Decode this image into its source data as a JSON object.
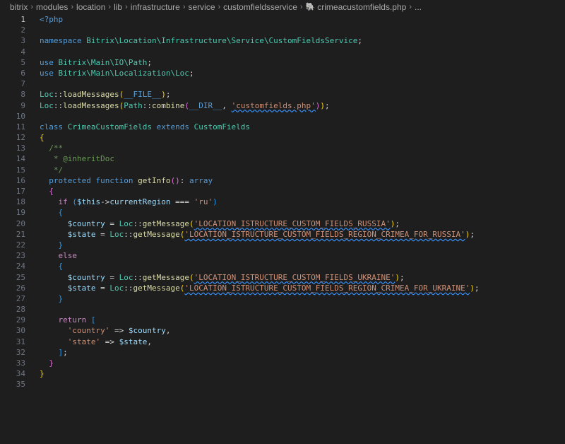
{
  "breadcrumb": {
    "items": [
      "bitrix",
      "modules",
      "location",
      "lib",
      "infrastructure",
      "service",
      "customfieldsservice"
    ],
    "file": "crimeacustomfields.php",
    "more": "..."
  },
  "editor": {
    "current_line": 1,
    "line_numbers": [
      "1",
      "2",
      "3",
      "4",
      "5",
      "6",
      "7",
      "8",
      "9",
      "10",
      "11",
      "12",
      "13",
      "14",
      "15",
      "16",
      "17",
      "18",
      "19",
      "20",
      "21",
      "22",
      "23",
      "24",
      "25",
      "26",
      "27",
      "28",
      "29",
      "30",
      "31",
      "32",
      "33",
      "34",
      "35"
    ],
    "lines": [
      [
        {
          "t": "<?php",
          "c": "tag"
        }
      ],
      [],
      [
        {
          "t": "namespace ",
          "c": "k"
        },
        {
          "t": "Bitrix\\Location\\Infrastructure\\Service\\CustomFieldsService",
          "c": "c"
        },
        {
          "t": ";",
          "c": "n"
        }
      ],
      [],
      [
        {
          "t": "use ",
          "c": "k"
        },
        {
          "t": "Bitrix\\Main\\IO\\Path",
          "c": "c"
        },
        {
          "t": ";",
          "c": "n"
        }
      ],
      [
        {
          "t": "use ",
          "c": "k"
        },
        {
          "t": "Bitrix\\Main\\Localization\\Loc",
          "c": "c"
        },
        {
          "t": ";",
          "c": "n"
        }
      ],
      [],
      [
        {
          "t": "Loc",
          "c": "c"
        },
        {
          "t": "::",
          "c": "n"
        },
        {
          "t": "loadMessages",
          "c": "f"
        },
        {
          "t": "(",
          "c": "b1"
        },
        {
          "t": "__FILE__",
          "c": "k"
        },
        {
          "t": ")",
          "c": "b1"
        },
        {
          "t": ";",
          "c": "n"
        }
      ],
      [
        {
          "t": "Loc",
          "c": "c"
        },
        {
          "t": "::",
          "c": "n"
        },
        {
          "t": "loadMessages",
          "c": "f"
        },
        {
          "t": "(",
          "c": "b1"
        },
        {
          "t": "Path",
          "c": "c"
        },
        {
          "t": "::",
          "c": "n"
        },
        {
          "t": "combine",
          "c": "f"
        },
        {
          "t": "(",
          "c": "b2"
        },
        {
          "t": "__DIR__",
          "c": "k"
        },
        {
          "t": ", ",
          "c": "n"
        },
        {
          "t": "'customfields.php'",
          "c": "s",
          "sq": true
        },
        {
          "t": ")",
          "c": "b2"
        },
        {
          "t": ")",
          "c": "b1"
        },
        {
          "t": ";",
          "c": "n"
        }
      ],
      [],
      [
        {
          "t": "class ",
          "c": "k"
        },
        {
          "t": "CrimeaCustomFields ",
          "c": "c"
        },
        {
          "t": "extends ",
          "c": "k"
        },
        {
          "t": "CustomFields",
          "c": "c"
        }
      ],
      [
        {
          "t": "{",
          "c": "b1"
        }
      ],
      [
        {
          "t": "  ",
          "c": "guide"
        },
        {
          "t": "/**",
          "c": "cm"
        }
      ],
      [
        {
          "t": "  ",
          "c": "guide"
        },
        {
          "t": " * @inheritDoc",
          "c": "cm"
        }
      ],
      [
        {
          "t": "  ",
          "c": "guide"
        },
        {
          "t": " */",
          "c": "cm"
        }
      ],
      [
        {
          "t": "  ",
          "c": "guide"
        },
        {
          "t": "protected ",
          "c": "k"
        },
        {
          "t": "function ",
          "c": "k"
        },
        {
          "t": "getInfo",
          "c": "f"
        },
        {
          "t": "()",
          "c": "b2"
        },
        {
          "t": ": ",
          "c": "n"
        },
        {
          "t": "array",
          "c": "k"
        }
      ],
      [
        {
          "t": "  ",
          "c": "guide"
        },
        {
          "t": "{",
          "c": "b2"
        }
      ],
      [
        {
          "t": "    ",
          "c": "guide"
        },
        {
          "t": "if ",
          "c": "kc"
        },
        {
          "t": "(",
          "c": "b3"
        },
        {
          "t": "$this",
          "c": "v"
        },
        {
          "t": "->",
          "c": "n"
        },
        {
          "t": "currentRegion ",
          "c": "v"
        },
        {
          "t": "=== ",
          "c": "n"
        },
        {
          "t": "'ru'",
          "c": "s"
        },
        {
          "t": ")",
          "c": "b3"
        }
      ],
      [
        {
          "t": "    ",
          "c": "guide"
        },
        {
          "t": "{",
          "c": "b3"
        }
      ],
      [
        {
          "t": "      ",
          "c": "guide"
        },
        {
          "t": "$country ",
          "c": "v"
        },
        {
          "t": "= ",
          "c": "n"
        },
        {
          "t": "Loc",
          "c": "c"
        },
        {
          "t": "::",
          "c": "n"
        },
        {
          "t": "getMessage",
          "c": "f"
        },
        {
          "t": "(",
          "c": "b1"
        },
        {
          "t": "'LOCATION_ISTRUCTURE_CUSTOM_FIELDS_RUSSIA'",
          "c": "s",
          "sq": true
        },
        {
          "t": ")",
          "c": "b1"
        },
        {
          "t": ";",
          "c": "n"
        }
      ],
      [
        {
          "t": "      ",
          "c": "guide"
        },
        {
          "t": "$state ",
          "c": "v"
        },
        {
          "t": "= ",
          "c": "n"
        },
        {
          "t": "Loc",
          "c": "c"
        },
        {
          "t": "::",
          "c": "n"
        },
        {
          "t": "getMessage",
          "c": "f"
        },
        {
          "t": "(",
          "c": "b1"
        },
        {
          "t": "'LOCATION_ISTRUCTURE_CUSTOM_FIELDS_REGION_CRIMEA_FOR_RUSSIA'",
          "c": "s",
          "sq": true
        },
        {
          "t": ")",
          "c": "b1"
        },
        {
          "t": ";",
          "c": "n"
        }
      ],
      [
        {
          "t": "    ",
          "c": "guide"
        },
        {
          "t": "}",
          "c": "b3"
        }
      ],
      [
        {
          "t": "    ",
          "c": "guide"
        },
        {
          "t": "else",
          "c": "kc"
        }
      ],
      [
        {
          "t": "    ",
          "c": "guide"
        },
        {
          "t": "{",
          "c": "b3"
        }
      ],
      [
        {
          "t": "      ",
          "c": "guide"
        },
        {
          "t": "$country ",
          "c": "v"
        },
        {
          "t": "= ",
          "c": "n"
        },
        {
          "t": "Loc",
          "c": "c"
        },
        {
          "t": "::",
          "c": "n"
        },
        {
          "t": "getMessage",
          "c": "f"
        },
        {
          "t": "(",
          "c": "b1"
        },
        {
          "t": "'LOCATION_ISTRUCTURE_CUSTOM_FIELDS_UKRAINE'",
          "c": "s",
          "sq": true
        },
        {
          "t": ")",
          "c": "b1"
        },
        {
          "t": ";",
          "c": "n"
        }
      ],
      [
        {
          "t": "      ",
          "c": "guide"
        },
        {
          "t": "$state ",
          "c": "v"
        },
        {
          "t": "= ",
          "c": "n"
        },
        {
          "t": "Loc",
          "c": "c"
        },
        {
          "t": "::",
          "c": "n"
        },
        {
          "t": "getMessage",
          "c": "f"
        },
        {
          "t": "(",
          "c": "b1"
        },
        {
          "t": "'LOCATION_ISTRUCTURE_CUSTOM_FIELDS_REGION_CRIMEA_FOR_UKRAINE'",
          "c": "s",
          "sq": true
        },
        {
          "t": ")",
          "c": "b1"
        },
        {
          "t": ";",
          "c": "n"
        }
      ],
      [
        {
          "t": "    ",
          "c": "guide"
        },
        {
          "t": "}",
          "c": "b3"
        }
      ],
      [],
      [
        {
          "t": "    ",
          "c": "guide"
        },
        {
          "t": "return ",
          "c": "kc"
        },
        {
          "t": "[",
          "c": "b3"
        }
      ],
      [
        {
          "t": "      ",
          "c": "guide"
        },
        {
          "t": "'country' ",
          "c": "s"
        },
        {
          "t": "=> ",
          "c": "n"
        },
        {
          "t": "$country",
          "c": "v"
        },
        {
          "t": ",",
          "c": "n"
        }
      ],
      [
        {
          "t": "      ",
          "c": "guide"
        },
        {
          "t": "'state' ",
          "c": "s"
        },
        {
          "t": "=> ",
          "c": "n"
        },
        {
          "t": "$state",
          "c": "v"
        },
        {
          "t": ",",
          "c": "n"
        }
      ],
      [
        {
          "t": "    ",
          "c": "guide"
        },
        {
          "t": "]",
          "c": "b3"
        },
        {
          "t": ";",
          "c": "n"
        }
      ],
      [
        {
          "t": "  ",
          "c": "guide"
        },
        {
          "t": "}",
          "c": "b2"
        }
      ],
      [
        {
          "t": "}",
          "c": "b1"
        }
      ],
      []
    ]
  }
}
